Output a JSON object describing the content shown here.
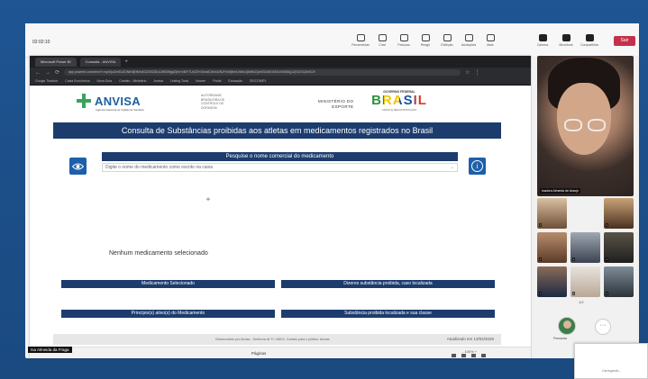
{
  "meeting": {
    "time": "02:02:10",
    "toolbar": [
      "Ferramentas",
      "Chat",
      "Pessoas",
      "Reagir",
      "Exibição",
      "Anotações",
      "Mais",
      "Câmera",
      "Microfone",
      "Compartilhar"
    ],
    "leave_label": "Sair",
    "presenter_label": "Isa Almeida da Fraga",
    "pager": "1/2",
    "avatar_name": "Fernanda",
    "popup_label": "Carregando..."
  },
  "browser": {
    "tabs": [
      "Microsoft Power BI",
      "Consulta - ANVISA"
    ],
    "url": "app.powerbi.com/view?r=eyJrIjoiZmEzZDNhNjEtMmE3Zi00ZDk1LWE0MjgtZjlmYzBiYTUxZDY4IiwidCI6ImI2N2FmMjNmLWMzZjMtNGQzNS04MGM3LWI3MDg1ZjVlZGQ4MSJ9",
    "bookmarks": [
      "Google Tradutor",
      "Caixa Econômica",
      "Nova Guia",
      "Contato - Ministério",
      "Anvisa",
      "Linking Tools",
      "Nuvem",
      "Portal",
      "Educação",
      "SISCOMEX"
    ]
  },
  "page": {
    "autor_lines": [
      "AUTORIDADE",
      "BRASILEIRA DE",
      "CONTROLE DE",
      "DOPAGEM"
    ],
    "anvisa_name": "ANVISA",
    "anvisa_sub": "Agência Nacional de Vigilância Sanitária",
    "ministerio_lines": [
      "MINISTÉRIO DO",
      "ESPORTE"
    ],
    "gov_federal": "GOVERNO FEDERAL",
    "brasil": "BRASIL",
    "gov_tag": "UNIÃO E RECONSTRUÇÃO",
    "title": "Consulta de Substâncias proibidas aos atletas em medicamentos registrados no Brasil",
    "search_header": "Pesquise o nome comercial do medicamento",
    "search_placeholder": "Digite o nome do medicamento como escrito na caixa",
    "section_selected": "Medicamento Selecionado",
    "section_prohibited": "Dizeres substância proibida, caso localizada",
    "none_selected": "Nenhum medicamento selecionado",
    "section_active": "Princípio(s) ativo(s) do Medicamento",
    "section_class": "Substância proibida localizada e sua classe",
    "footer_text": "Desenvolvido por Anvisa - Gerência de TI / ABCD. Contato para o público: Anvisa",
    "updated": "Atualizado em 13/02/2025",
    "pages_label": "Páginas",
    "zoom": "- 100% +"
  },
  "colors": {
    "navy": "#1d3c6e",
    "icon_blue": "#1d5faa",
    "anvisa_green": "#3aa35a",
    "teams_bg": "#1d4f8c",
    "leave_red": "#c4314b"
  },
  "participants": [
    {
      "name": "Isadora Almeida de Araujo",
      "icon": "participant-video"
    }
  ]
}
